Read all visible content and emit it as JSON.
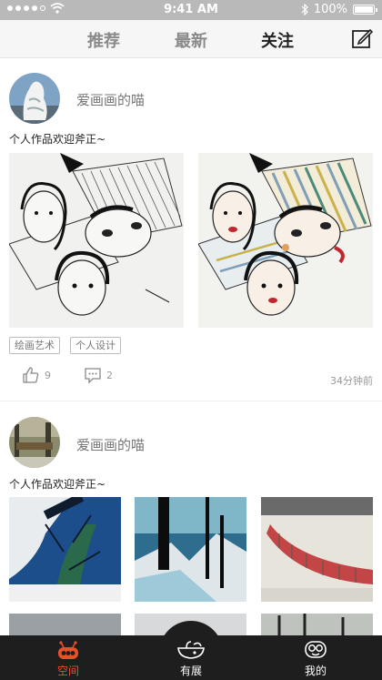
{
  "status_bar": {
    "time": "9:41 AM",
    "battery": "100%",
    "battery_level": 1.0
  },
  "top_nav": {
    "tabs": [
      {
        "label": "推荐",
        "active": false
      },
      {
        "label": "最新",
        "active": false
      },
      {
        "label": "关注",
        "active": true
      }
    ],
    "edit_icon": "edit-icon"
  },
  "posts": [
    {
      "username": "爱画画的喵",
      "description": "个人作品欢迎斧正~",
      "tags": [
        "绘画艺术",
        "个人设计"
      ],
      "likes": "9",
      "comments": "2",
      "time": "34分钟前"
    },
    {
      "username": "爱画画的喵",
      "description": "个人作品欢迎斧正~"
    }
  ],
  "tab_bar": {
    "items": [
      {
        "label": "空间",
        "icon": "space-robot-icon",
        "active": true
      },
      {
        "label": "有展",
        "icon": "exhibition-icon",
        "active": false
      },
      {
        "label": "我的",
        "icon": "profile-icon",
        "active": false
      }
    ]
  },
  "colors": {
    "accent": "#e8502a",
    "tab_bar_bg": "#1e1e1e",
    "status_bar_bg": "#b9b9b9"
  }
}
